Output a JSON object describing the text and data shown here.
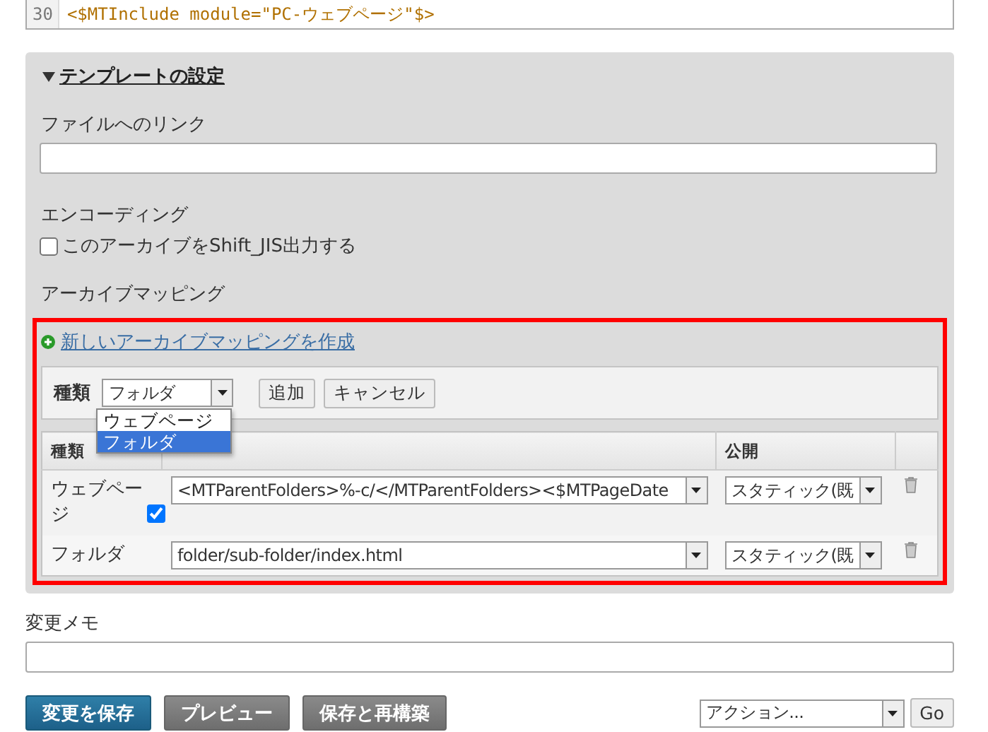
{
  "code": {
    "line_number": "30",
    "line": "<$MTInclude module=\"PC-ウェブページ\"$>"
  },
  "settings": {
    "title": "テンプレートの設定",
    "expanded": true,
    "link_label": "ファイルへのリンク",
    "encoding_label": "エンコーディング",
    "encoding_checkbox": {
      "label": "このアーカイブをShift_JIS出力する",
      "checked": false
    },
    "mapping_label": "アーカイブマッピング",
    "create_link": "新しいアーカイブマッピングを作成",
    "type_label": "種類",
    "type_select": "フォルダ",
    "type_options": [
      {
        "label": "ウェブページ",
        "selected": false
      },
      {
        "label": "フォルダ",
        "selected": true
      }
    ],
    "add_button": "追加",
    "cancel_button": "キャンセル",
    "columns": [
      "種類",
      "公開"
    ],
    "rows": [
      {
        "type": "ウェブページ",
        "preferred": true,
        "path": "<MTParentFolders>%-c/</MTParentFolders><$MTPageDate",
        "publish": "スタティック(既"
      },
      {
        "type": "フォルダ",
        "path": "folder/sub-folder/index.html",
        "publish": "スタティック(既"
      }
    ]
  },
  "memo_label": "変更メモ",
  "buttons": [
    {
      "label": "変更を保存",
      "kind": "primary"
    },
    {
      "label": "プレビュー",
      "kind": "secondary"
    },
    {
      "label": "保存と再構築",
      "kind": "secondary"
    }
  ],
  "action_select": "アクション...",
  "go_button": "Go"
}
